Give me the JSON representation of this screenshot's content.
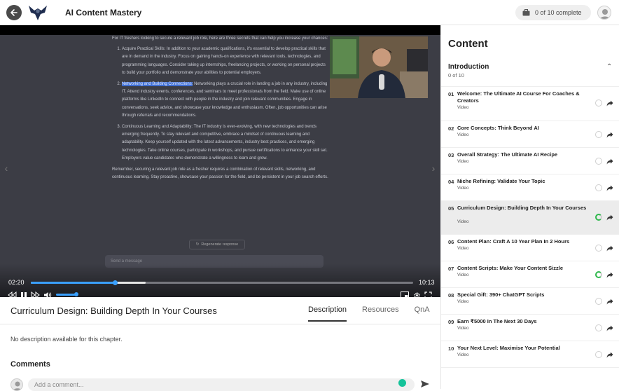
{
  "header": {
    "title": "AI Content Mastery",
    "progress_text": "0 of 10 complete"
  },
  "video": {
    "chat": {
      "intro": "For IT freshers looking to secure a relevant job role, here are three secrets that can help you increase your chances:",
      "items": [
        {
          "lead": "Acquire Practical Skills:",
          "text": " In addition to your academic qualifications, it's essential to develop practical skills that are in demand in the industry. Focus on gaining hands-on experience with relevant tools, technologies, and programming languages. Consider taking up internships, freelancing projects, or working on personal projects to build your portfolio and demonstrate your abilities to potential employers."
        },
        {
          "lead": "Networking and Building Connections:",
          "text": " Networking plays a crucial role in landing a job in any industry, including IT. Attend industry events, conferences, and seminars to meet professionals from the field. Make use of online platforms like LinkedIn to connect with people in the industry and join relevant communities. Engage in conversations, seek advice, and showcase your knowledge and enthusiasm. Often, job opportunities can arise through referrals and recommendations."
        },
        {
          "lead": "Continuous Learning and Adaptability:",
          "text": " The IT industry is ever-evolving, with new technologies and trends emerging frequently. To stay relevant and competitive, embrace a mindset of continuous learning and adaptability. Keep yourself updated with the latest advancements, industry best practices, and emerging technologies. Take online courses, participate in workshops, and pursue certifications to enhance your skill set. Employers value candidates who demonstrate a willingness to learn and grow."
        }
      ],
      "outro": "Remember, securing a relevant job role as a fresher requires a combination of relevant skills, networking, and continuous learning. Stay proactive, showcase your passion for the field, and be persistent in your job search efforts.",
      "regenerate_label": "Regenerate response",
      "message_placeholder": "Send a message"
    },
    "current_time": "02:20",
    "duration": "10:13",
    "played_fraction": 0.22,
    "buffered_fraction": 0.3,
    "volume_fraction": 0.9,
    "accent_color": "#3aa0ff"
  },
  "chapter": {
    "title": "Curriculum Design: Building Depth In Your Courses",
    "tabs": [
      "Description",
      "Resources",
      "QnA"
    ],
    "active_tab": "Description",
    "description": "No description available for this chapter.",
    "comments_heading": "Comments",
    "comment_placeholder": "Add a comment..."
  },
  "sidebar": {
    "title": "Content",
    "section": {
      "name": "Introduction",
      "count": "0 of 10"
    },
    "lessons": [
      {
        "num": "01",
        "title": "Welcome: The Ultimate AI Course For Coaches & Creators",
        "type": "Video",
        "status": "none"
      },
      {
        "num": "02",
        "title": "Core Concepts: Think Beyond AI",
        "type": "Video",
        "status": "none"
      },
      {
        "num": "03",
        "title": "Overall Strategy: The Ultimate AI Recipe",
        "type": "Video",
        "status": "none"
      },
      {
        "num": "04",
        "title": "Niche Refining: Validate Your Topic",
        "type": "Video",
        "status": "none"
      },
      {
        "num": "05",
        "title": "Curriculum Design: Building Depth In Your Courses",
        "type": "Video",
        "status": "partial",
        "active": true
      },
      {
        "num": "06",
        "title": "Content Plan: Craft A 10 Year Plan In 2 Hours",
        "type": "Video",
        "status": "none"
      },
      {
        "num": "07",
        "title": "Content Scripts: Make Your Content Sizzle",
        "type": "Video",
        "status": "partial"
      },
      {
        "num": "08",
        "title": "Special Gift: 390+ ChatGPT Scripts",
        "type": "Video",
        "status": "none"
      },
      {
        "num": "09",
        "title": "Earn ₹5000 In The Next 30 Days",
        "type": "Video",
        "status": "none"
      },
      {
        "num": "10",
        "title": "Your Next Level: Maximise Your Potential",
        "type": "Video",
        "status": "none"
      }
    ]
  }
}
